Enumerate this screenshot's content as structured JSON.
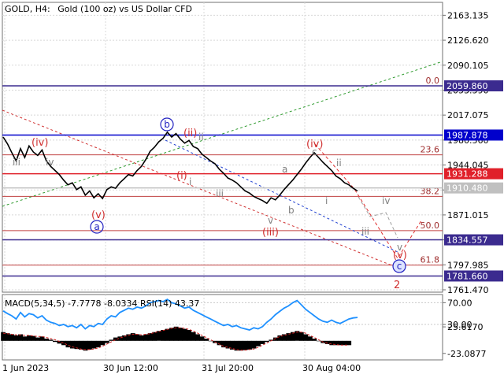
{
  "header": {
    "symbol": "GOLD, H4:",
    "description": "Gold (100 oz) vs US Dollar CFD"
  },
  "chart_data": {
    "type": "line",
    "main": {
      "ylim": [
        1758,
        2182
      ],
      "y_ticks": [
        "2163.135",
        "2126.620",
        "2090.105",
        "2053.590",
        "2017.075",
        "1980.560",
        "1944.045",
        "1907.530",
        "1871.015",
        "1834.500",
        "1797.985",
        "1761.470"
      ],
      "levels": [
        {
          "value": 2059.86,
          "label": "2059.860",
          "color": "#3b2b8f",
          "fib": "0.0"
        },
        {
          "value": 1987.878,
          "label": "1987.878",
          "color": "#0000cc"
        },
        {
          "value": 1931.288,
          "label": "1931.288",
          "color": "#e0202a"
        },
        {
          "value": 1910.48,
          "label": "1910.480",
          "color": "#c0c0c0"
        },
        {
          "value": 1834.557,
          "label": "1834.557",
          "color": "#3b2b8f"
        },
        {
          "value": 1781.66,
          "label": "1781.660",
          "color": "#3b2b8f"
        }
      ],
      "fib_levels": [
        {
          "value": 1958.9,
          "label": "23.6"
        },
        {
          "value": 1898.2,
          "label": "38.2"
        },
        {
          "value": 1848.0,
          "label": "50.0"
        },
        {
          "value": 1797.6,
          "label": "61.8"
        }
      ],
      "wave_labels_red": [
        "(iv)",
        "(v)",
        "(ii)",
        "(i)",
        "(iii)",
        "(iv)",
        "(v)",
        "2"
      ],
      "wave_labels_gray": [
        "iii",
        "iv",
        "i",
        "ii",
        "iii",
        "v",
        "a",
        "b",
        "c",
        "i",
        "ii",
        "iv",
        "iii",
        "v"
      ],
      "wave_labels_circled": [
        "a",
        "b",
        "c"
      ],
      "price": [
        1985,
        1975,
        1962,
        1950,
        1968,
        1955,
        1972,
        1963,
        1958,
        1966,
        1950,
        1942,
        1936,
        1930,
        1922,
        1915,
        1918,
        1908,
        1912,
        1900,
        1906,
        1896,
        1902,
        1895,
        1908,
        1912,
        1910,
        1918,
        1924,
        1930,
        1928,
        1936,
        1942,
        1952,
        1964,
        1970,
        1978,
        1983,
        1992,
        1985,
        1990,
        1982,
        1976,
        1980,
        1971,
        1968,
        1960,
        1955,
        1950,
        1946,
        1938,
        1932,
        1925,
        1922,
        1918,
        1912,
        1906,
        1903,
        1898,
        1895,
        1892,
        1888,
        1896,
        1893,
        1900,
        1908,
        1915,
        1922,
        1930,
        1938,
        1947,
        1955,
        1962,
        1955,
        1948,
        1942,
        1936,
        1928,
        1924,
        1918,
        1915,
        1910,
        1906
      ]
    },
    "macd": {
      "label": "MACD(5,34,5) -7.7778 -8.0334 RSI(14) 43.37",
      "ylim": [
        -35,
        85
      ],
      "y_ticks": [
        "25.6170",
        "70.00",
        "30.00",
        "-23.0877"
      ],
      "hist": [
        16,
        14,
        12,
        10,
        12,
        8,
        10,
        9,
        6,
        8,
        4,
        2,
        -2,
        -5,
        -8,
        -12,
        -14,
        -15,
        -16,
        -18,
        -16,
        -14,
        -12,
        -8,
        -4,
        2,
        6,
        8,
        10,
        12,
        14,
        12,
        10,
        12,
        14,
        16,
        18,
        20,
        22,
        24,
        26,
        24,
        22,
        20,
        16,
        12,
        8,
        4,
        0,
        -4,
        -8,
        -12,
        -14,
        -16,
        -18,
        -18,
        -17,
        -16,
        -14,
        -10,
        -6,
        -2,
        2,
        6,
        10,
        12,
        14,
        16,
        18,
        16,
        12,
        8,
        4,
        0,
        -4,
        -6,
        -8,
        -8,
        -8,
        -8,
        -8
      ],
      "signal": [
        14,
        13,
        12,
        11,
        11,
        10,
        10,
        9,
        8,
        8,
        6,
        4,
        2,
        -1,
        -4,
        -8,
        -11,
        -13,
        -15,
        -16,
        -16,
        -15,
        -13,
        -10,
        -6,
        -2,
        2,
        5,
        8,
        10,
        12,
        12,
        11,
        12,
        13,
        15,
        17,
        19,
        21,
        23,
        24,
        24,
        23,
        21,
        18,
        14,
        10,
        6,
        2,
        -2,
        -6,
        -10,
        -12,
        -14,
        -16,
        -17,
        -17,
        -16,
        -15,
        -12,
        -8,
        -4,
        0,
        4,
        8,
        10,
        12,
        14,
        16,
        16,
        14,
        10,
        6,
        2,
        -2,
        -4,
        -6,
        -7,
        -8,
        -8,
        -8
      ],
      "rsi": [
        55,
        50,
        46,
        40,
        52,
        44,
        50,
        48,
        42,
        46,
        38,
        34,
        32,
        28,
        30,
        26,
        28,
        24,
        30,
        22,
        28,
        26,
        32,
        30,
        40,
        46,
        44,
        52,
        56,
        60,
        58,
        62,
        60,
        64,
        70,
        72,
        74,
        72,
        76,
        70,
        68,
        64,
        60,
        62,
        56,
        52,
        48,
        44,
        40,
        36,
        32,
        28,
        30,
        26,
        28,
        24,
        22,
        20,
        24,
        22,
        26,
        34,
        40,
        48,
        54,
        60,
        64,
        70,
        74,
        66,
        58,
        52,
        46,
        40,
        36,
        34,
        38,
        34,
        32,
        36,
        40,
        42,
        43
      ]
    },
    "x_ticks": [
      "1 Jun 2023",
      "30 Jun 12:00",
      "31 Jul 20:00",
      "30 Aug 04:00"
    ]
  }
}
